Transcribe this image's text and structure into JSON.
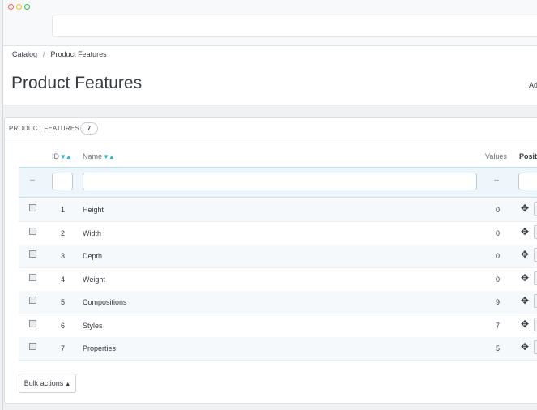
{
  "breadcrumb": {
    "items": [
      "Catalog",
      "Product Features"
    ],
    "separator": "/"
  },
  "page": {
    "title": "Product Features",
    "header_right": "Ad"
  },
  "panel": {
    "title": "PRODUCT FEATURES",
    "count": "7"
  },
  "table": {
    "columns": {
      "id": "ID",
      "name": "Name",
      "values": "Values",
      "position": "Positi"
    },
    "sort_arrows": "▼▲",
    "filter": {
      "dash_left": "--",
      "dash_values": "--"
    },
    "rows": [
      {
        "id": "1",
        "name": "Height",
        "values": "0"
      },
      {
        "id": "2",
        "name": "Width",
        "values": "0"
      },
      {
        "id": "3",
        "name": "Depth",
        "values": "0"
      },
      {
        "id": "4",
        "name": "Weight",
        "values": "0"
      },
      {
        "id": "5",
        "name": "Compositions",
        "values": "9"
      },
      {
        "id": "6",
        "name": "Styles",
        "values": "7"
      },
      {
        "id": "7",
        "name": "Properties",
        "values": "5"
      }
    ]
  },
  "bulk_actions": {
    "label": "Bulk actions",
    "caret": "▲"
  },
  "icons": {
    "move": "move-arrows-icon",
    "window_dots": "window-controls"
  },
  "colors": {
    "accent": "#25b9d7",
    "filter_bg": "#eef6fb",
    "text": "#363a41"
  }
}
